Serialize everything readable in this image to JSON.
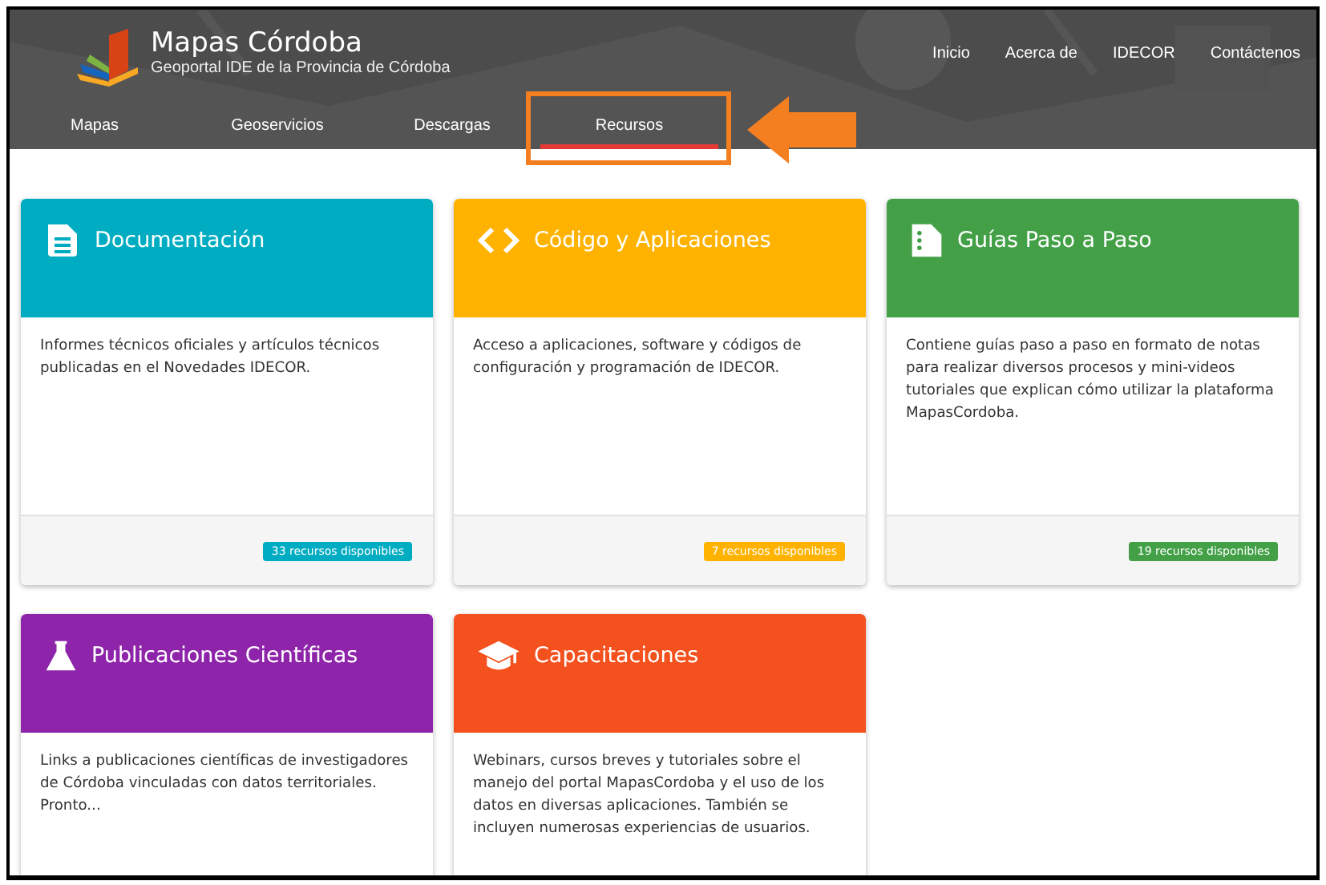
{
  "header": {
    "title": "Mapas Córdoba",
    "subtitle": "Geoportal IDE de la Provincia de Córdoba",
    "top_links": [
      "Inicio",
      "Acerca de",
      "IDECOR",
      "Contáctenos"
    ],
    "tabs": [
      {
        "label": "Mapas",
        "selected": false
      },
      {
        "label": "Geoservicios",
        "selected": false
      },
      {
        "label": "Descargas",
        "selected": false
      },
      {
        "label": "Recursos",
        "selected": true
      }
    ]
  },
  "cards": [
    {
      "kind": "document",
      "color": "#00acc1",
      "title": "Documentación",
      "description": "Informes técnicos oficiales y artículos técnicos publicadas en el Novedades IDECOR.",
      "badge": "33 recursos disponibles"
    },
    {
      "kind": "code",
      "color": "#ffb300",
      "title": "Código y Aplicaciones",
      "description": "Acceso a aplicaciones, software y códigos de configuración y programación de IDECOR.",
      "badge": "7 recursos disponibles"
    },
    {
      "kind": "guide",
      "color": "#43a047",
      "title": "Guías Paso a Paso",
      "description": "Contiene guías paso a paso en formato de notas para realizar diversos procesos y mini-videos tutoriales que explican cómo utilizar la plataforma MapasCordoba.",
      "badge": "19 recursos disponibles"
    },
    {
      "kind": "flask",
      "color": "#8e24aa",
      "title": "Publicaciones Científicas",
      "description": "Links a publicaciones científicas de investigadores de Córdoba vinculadas con datos territoriales. Pronto..."
    },
    {
      "kind": "cap",
      "color": "#f4511e",
      "title": "Capacitaciones",
      "description": "Webinars, cursos breves y tutoriales sobre el manejo del portal MapasCordoba y el uso de los datos en diversas aplicaciones. También se incluyen numerosas experiencias de usuarios."
    }
  ]
}
